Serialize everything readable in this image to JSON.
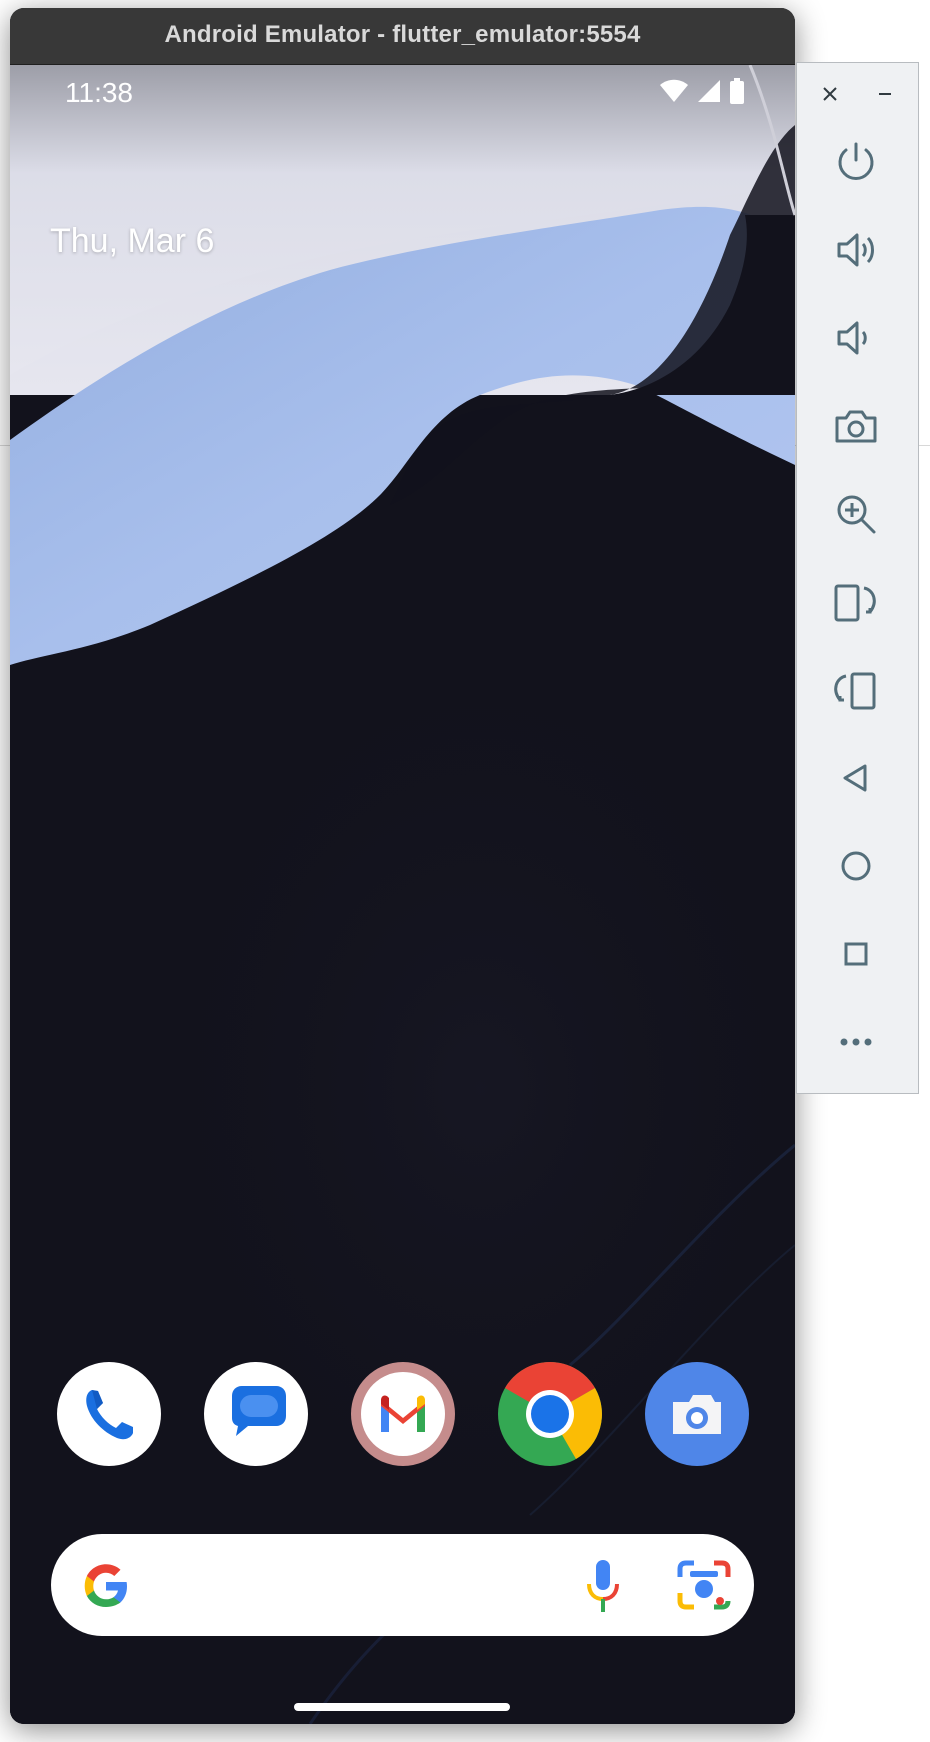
{
  "window": {
    "title": "Android Emulator - flutter_emulator:5554"
  },
  "status_bar": {
    "time": "11:38",
    "icons": [
      "wifi-icon",
      "cellular-signal-icon",
      "battery-icon"
    ]
  },
  "home": {
    "date": "Thu, Mar 6"
  },
  "dock": {
    "apps": [
      {
        "name": "Phone",
        "icon": "phone-icon"
      },
      {
        "name": "Messages",
        "icon": "messages-icon"
      },
      {
        "name": "Gmail",
        "icon": "gmail-icon"
      },
      {
        "name": "Chrome",
        "icon": "chrome-icon"
      },
      {
        "name": "Camera",
        "icon": "camera-icon"
      }
    ]
  },
  "search_bar": {
    "icons": [
      "google-g-icon",
      "microphone-icon",
      "google-lens-icon"
    ]
  },
  "side_panel": {
    "controls": [
      "close-icon",
      "minimize-icon",
      "power-icon",
      "volume-up-icon",
      "volume-down-icon",
      "screenshot-camera-icon",
      "zoom-icon",
      "rotate-left-icon",
      "rotate-right-icon",
      "back-icon",
      "home-icon",
      "overview-icon",
      "more-icon"
    ]
  },
  "colors": {
    "wallpaper_dark": "#12121c",
    "wallpaper_light": "#a9bde8",
    "accent_blue": "#4285f4",
    "google_red": "#ea4335",
    "google_yellow": "#fbbc05",
    "google_green": "#34a853",
    "panel_bg": "#eff1f3",
    "panel_icon": "#546e7a"
  }
}
